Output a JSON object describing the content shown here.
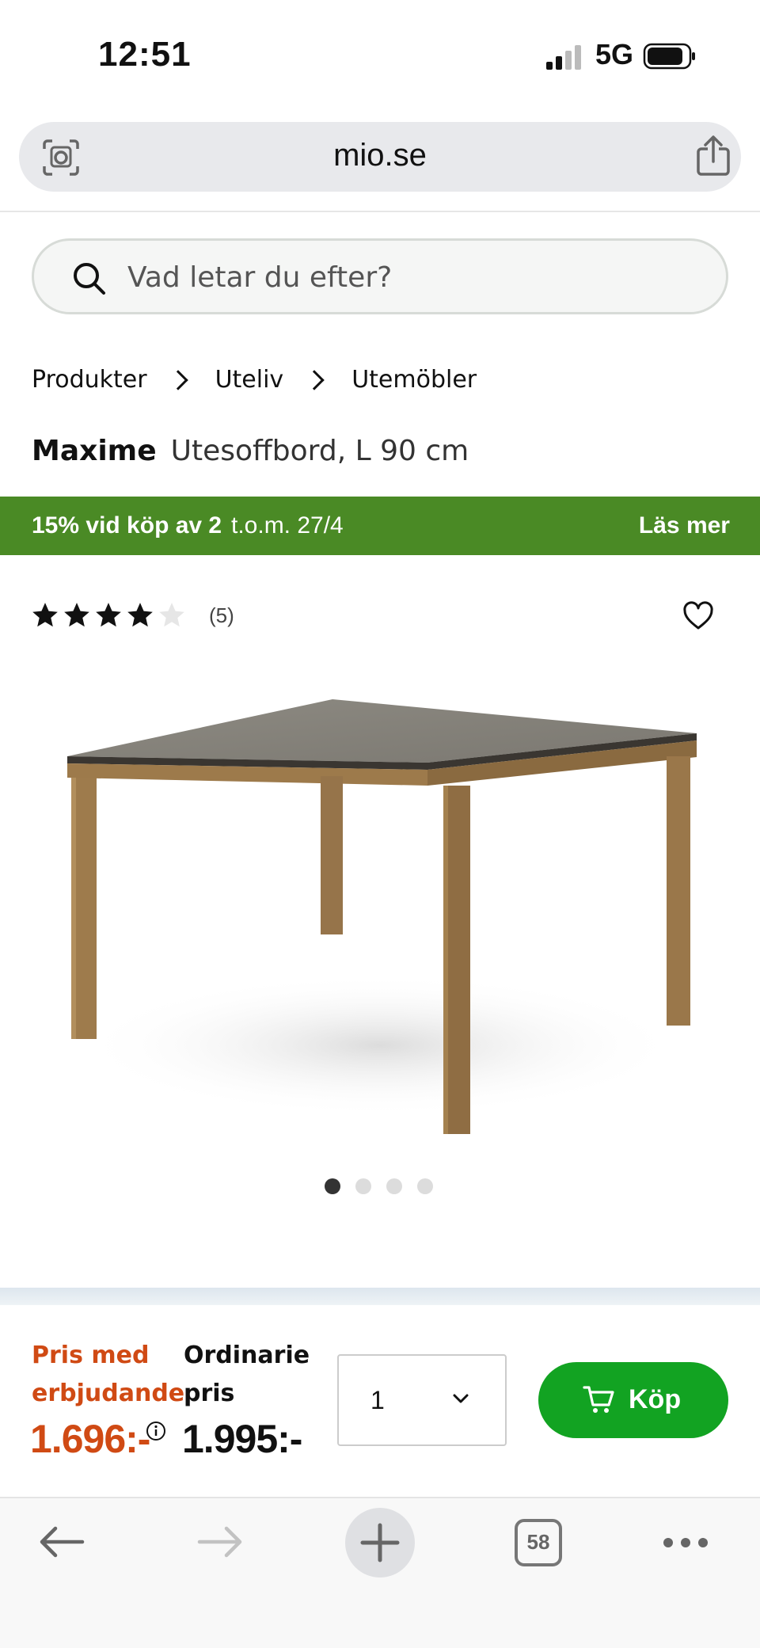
{
  "status_bar": {
    "time": "12:51",
    "network": "5G"
  },
  "browser": {
    "url": "mio.se",
    "tab_count": "58"
  },
  "search": {
    "placeholder": "Vad letar du efter?"
  },
  "breadcrumbs": [
    "Produkter",
    "Uteliv",
    "Utemöbler"
  ],
  "product": {
    "brand": "Maxime",
    "name": "Utesoffbord, L 90 cm",
    "rating": 4,
    "rating_max": 5,
    "review_count": "(5)",
    "image_count": 4,
    "active_image": 1
  },
  "promo": {
    "main": "15% vid köp av 2",
    "date": "t.o.m. 27/4",
    "link": "Läs mer",
    "color": "#4a8a25"
  },
  "price": {
    "offer_label": "Pris med erbjudande",
    "offer_price": "1.696:-",
    "regular_label": "Ordinarie pris",
    "regular_price": "1.995:-",
    "offer_color": "#d04a14"
  },
  "quantity": {
    "value": "1"
  },
  "buy_button": {
    "label": "Köp",
    "color": "#12a322"
  },
  "icons": [
    "camera-search-icon",
    "share-icon",
    "search-icon",
    "chevron-right-icon",
    "star-icon",
    "heart-icon",
    "info-icon",
    "chevron-down-icon",
    "cart-icon",
    "back-arrow-icon",
    "forward-arrow-icon",
    "plus-icon",
    "more-icon"
  ]
}
